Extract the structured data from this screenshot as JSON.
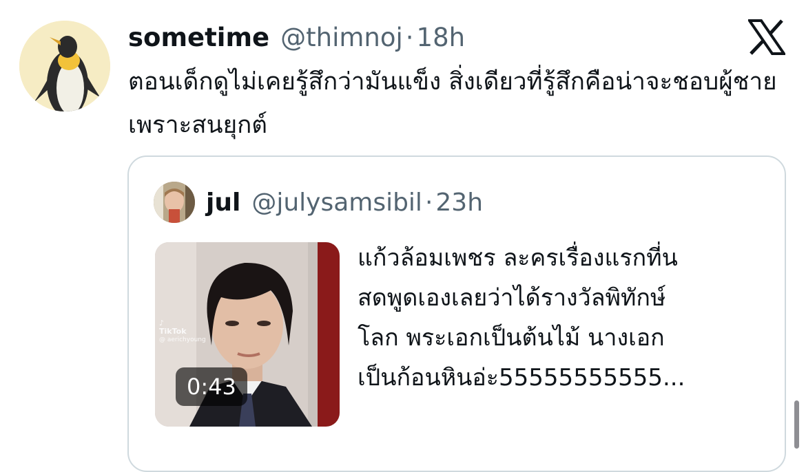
{
  "tweet": {
    "display_name": "sometime",
    "handle": "@thimnoj",
    "separator": "·",
    "time": "18h",
    "text": "ตอนเด็กดูไม่เคยรู้สึกว่ามันแข็ง สิ่งเดียวที่รู้สึกคือน่าจะชอบผู้ชายเพราะสนยุกต์"
  },
  "quoted": {
    "display_name": "jul",
    "handle": "@julysamsibil",
    "separator": "·",
    "time": "23h",
    "lines": [
      "แก้วล้อมเพชร ละครเรื่องแรกที่น",
      "สดพูดเองเลยว่าได้รางวัลพิทักษ์",
      "โลก พระเอกเป็นต้นไม้ นางเอก",
      "เป็นก้อนหินอ่ะ55555555555..."
    ],
    "video": {
      "duration": "0:43",
      "watermark_brand": "TikTok",
      "watermark_user": "@ aerichyoung"
    }
  },
  "icons": {
    "brand": "x-logo-icon"
  },
  "colors": {
    "text_primary": "#0f1419",
    "text_secondary": "#536471",
    "card_border": "#cfd9de"
  }
}
